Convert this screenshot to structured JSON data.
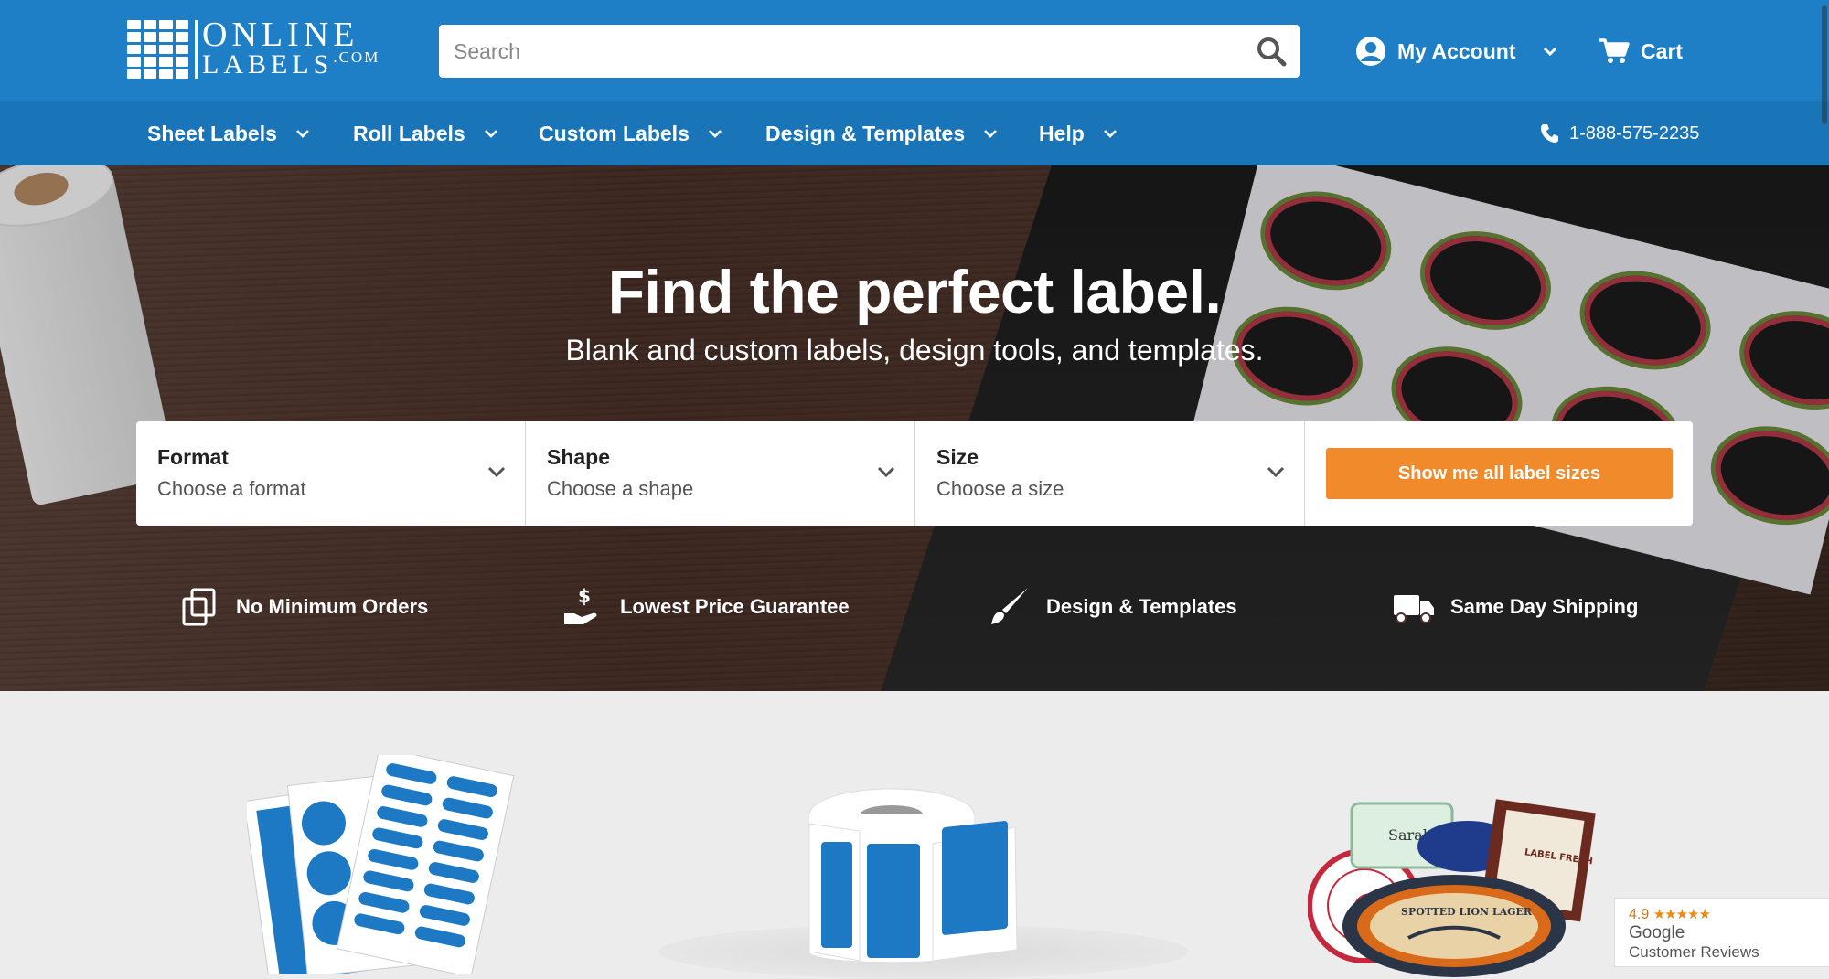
{
  "header": {
    "logo_line1": "ONLINE",
    "logo_line2": "LABELS",
    "logo_suffix": ".COM",
    "search_placeholder": "Search",
    "account_label": "My Account",
    "cart_label": "Cart"
  },
  "nav": {
    "items": [
      {
        "label": "Sheet Labels"
      },
      {
        "label": "Roll Labels"
      },
      {
        "label": "Custom Labels"
      },
      {
        "label": "Design & Templates"
      },
      {
        "label": "Help"
      }
    ],
    "phone": "1-888-575-2235"
  },
  "hero": {
    "title": "Find the perfect label.",
    "subtitle": "Blank and custom labels, design tools, and templates."
  },
  "finder": {
    "format": {
      "label": "Format",
      "value": "Choose a format"
    },
    "shape": {
      "label": "Shape",
      "value": "Choose a shape"
    },
    "size": {
      "label": "Size",
      "value": "Choose a size"
    },
    "button": "Show me all label sizes"
  },
  "features": [
    {
      "label": "No Minimum Orders",
      "icon": "documents-icon"
    },
    {
      "label": "Lowest Price Guarantee",
      "icon": "hand-dollar-icon"
    },
    {
      "label": "Design & Templates",
      "icon": "paintbrush-icon"
    },
    {
      "label": "Same Day Shipping",
      "icon": "truck-icon"
    }
  ],
  "categories": [
    {
      "name": "sheet-labels",
      "icon": "sheet-labels-icon"
    },
    {
      "name": "roll-labels",
      "icon": "roll-labels-icon"
    },
    {
      "name": "custom-labels",
      "icon": "custom-labels-icon"
    }
  ],
  "custom_label_texts": [
    "Sarah",
    "LABEL FRESH",
    "SPOTTED LION LAGER"
  ],
  "reviews": {
    "score": "4.9",
    "stars": "★★★★★",
    "brand": "Google",
    "caption": "Customer Reviews"
  },
  "colors": {
    "header_blue": "#1e7fc7",
    "nav_blue": "#1a74b8",
    "accent_orange": "#f08a2a",
    "label_blue": "#1d79c4"
  }
}
